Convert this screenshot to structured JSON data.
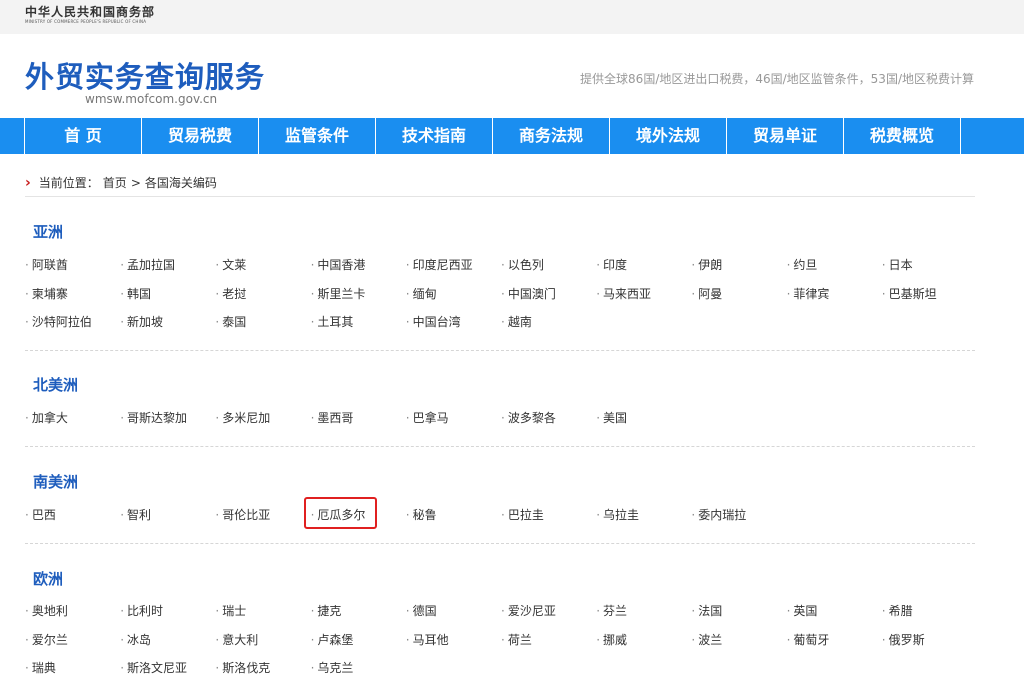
{
  "ministry": {
    "name_cn": "中华人民共和国商务部",
    "name_en": "MINISTRY OF COMMERCE PEOPLE'S REPUBLIC OF CHINA"
  },
  "site": {
    "title": "外贸实务查询服务",
    "domain": "wmsw.mofcom.gov.cn",
    "tagline": "提供全球86国/地区进出口税费，46国/地区监管条件，53国/地区税费计算"
  },
  "nav": [
    "首 页",
    "贸易税费",
    "监管条件",
    "技术指南",
    "商务法规",
    "境外法规",
    "贸易单证",
    "税费概览"
  ],
  "breadcrumb": {
    "label": "当前位置：",
    "home": "首页",
    "sep": ">",
    "current": "各国海关编码"
  },
  "regions": [
    {
      "title": "亚洲",
      "countries": [
        "阿联酋",
        "孟加拉国",
        "文莱",
        "中国香港",
        "印度尼西亚",
        "以色列",
        "印度",
        "伊朗",
        "约旦",
        "日本",
        "柬埔寨",
        "韩国",
        "老挝",
        "斯里兰卡",
        "缅甸",
        "中国澳门",
        "马来西亚",
        "阿曼",
        "菲律宾",
        "巴基斯坦",
        "沙特阿拉伯",
        "新加坡",
        "泰国",
        "土耳其",
        "中国台湾",
        "越南"
      ]
    },
    {
      "title": "北美洲",
      "countries": [
        "加拿大",
        "哥斯达黎加",
        "多米尼加",
        "墨西哥",
        "巴拿马",
        "波多黎各",
        "美国"
      ]
    },
    {
      "title": "南美洲",
      "countries": [
        "巴西",
        "智利",
        "哥伦比亚",
        "厄瓜多尔",
        "秘鲁",
        "巴拉圭",
        "乌拉圭",
        "委内瑞拉"
      ]
    },
    {
      "title": "欧洲",
      "countries": [
        "奥地利",
        "比利时",
        "瑞士",
        "捷克",
        "德国",
        "爱沙尼亚",
        "芬兰",
        "法国",
        "英国",
        "希腊",
        "爱尔兰",
        "冰岛",
        "意大利",
        "卢森堡",
        "马耳他",
        "荷兰",
        "挪威",
        "波兰",
        "葡萄牙",
        "俄罗斯",
        "瑞典",
        "斯洛文尼亚",
        "斯洛伐克",
        "乌克兰"
      ]
    }
  ],
  "selected_country": "厄瓜多尔"
}
